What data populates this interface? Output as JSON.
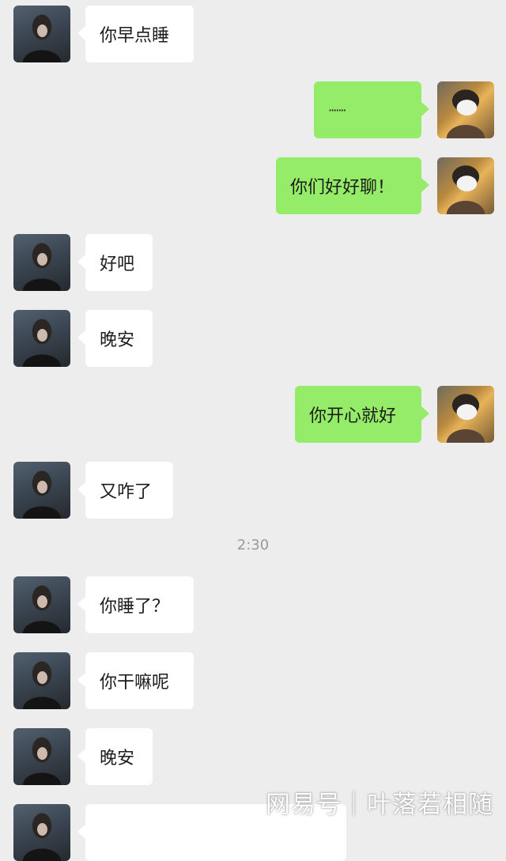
{
  "messages": [
    {
      "side": "left",
      "text": "你早点睡"
    },
    {
      "side": "right",
      "text": "·······"
    },
    {
      "side": "right",
      "text": "你们好好聊！"
    },
    {
      "side": "left",
      "text": "好吧"
    },
    {
      "side": "left",
      "text": "晚安"
    },
    {
      "side": "right",
      "text": "你开心就好"
    },
    {
      "side": "left",
      "text": "又咋了"
    },
    {
      "side": "left",
      "text": "你睡了？"
    },
    {
      "side": "left",
      "text": "你干嘛呢"
    },
    {
      "side": "left",
      "text": "晚安"
    },
    {
      "side": "left",
      "text": ""
    }
  ],
  "timestamp": "2:30",
  "watermark": "网易号｜叶落若相随",
  "colors": {
    "background": "#ededed",
    "self_bubble": "#95ec69",
    "other_bubble": "#ffffff"
  }
}
